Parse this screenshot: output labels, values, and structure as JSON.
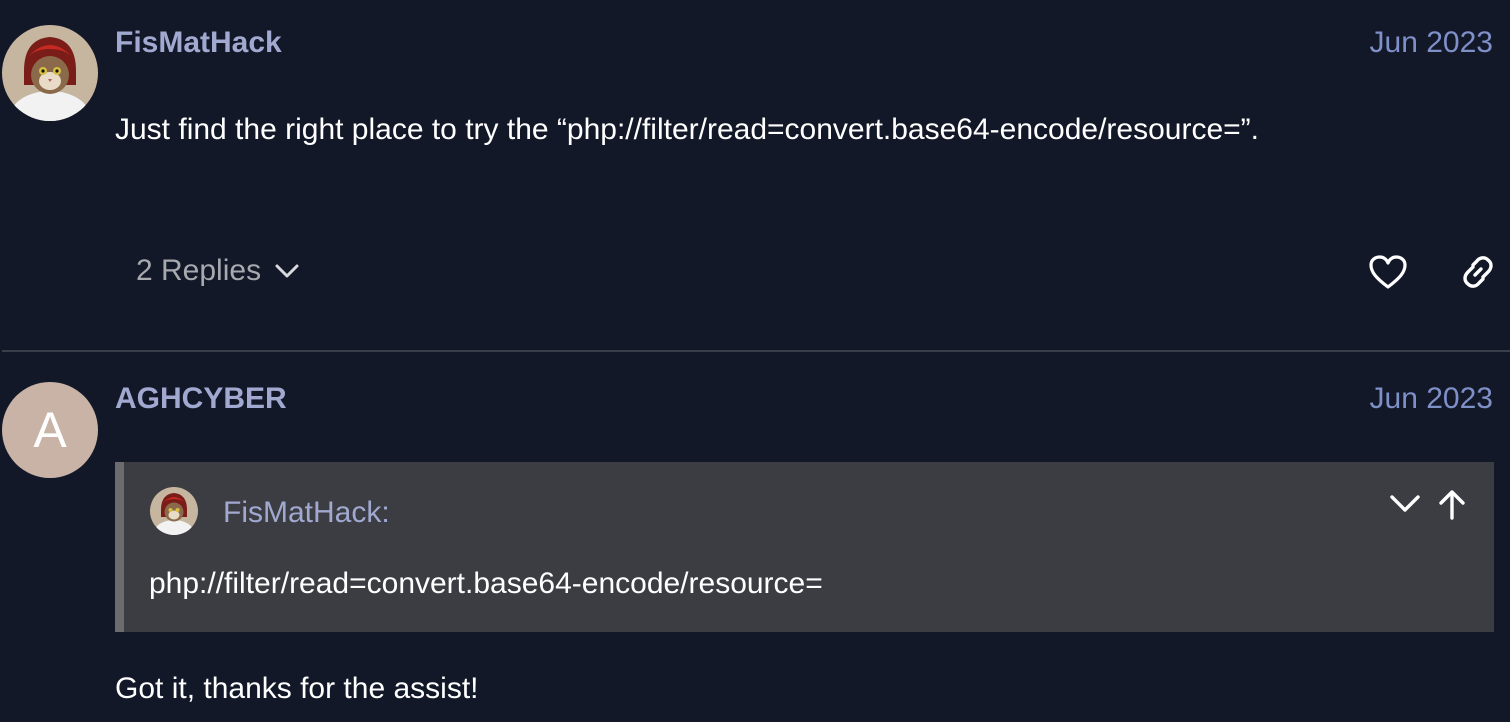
{
  "posts": [
    {
      "username": "FisMatHack",
      "date": "Jun 2023",
      "body": "Just find the right place to try the “php://filter/read=convert.base64-encode/resource=”.",
      "replies_label": "2 Replies",
      "avatar_icon": "cat-hoodie-avatar-icon",
      "actions": [
        "heart-icon",
        "link-icon"
      ]
    },
    {
      "username": "AGHCYBER",
      "date": "Jun 2023",
      "avatar_letter": "A",
      "avatar_color": "#c8b3a6",
      "quote": {
        "username": "FisMatHack:",
        "text": "php://filter/read=convert.base64-encode/resource=",
        "controls": [
          "chevron-down-icon",
          "arrow-up-icon"
        ]
      },
      "body": "Got it, thanks for the assist!"
    }
  ],
  "colors": {
    "background": "#131828",
    "username": "#a1a9d0",
    "date": "#7f90c9",
    "quote_bg": "#3c3d42"
  }
}
